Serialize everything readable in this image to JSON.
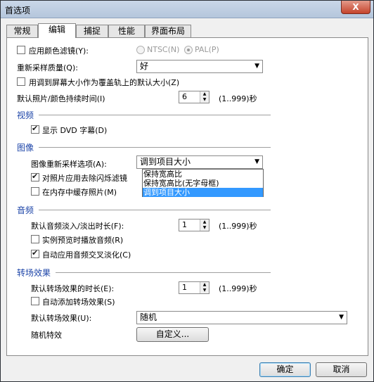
{
  "window": {
    "title": "首选项",
    "close_glyph": "X"
  },
  "tabs": [
    {
      "label": "常规"
    },
    {
      "label": "编辑"
    },
    {
      "label": "捕捉"
    },
    {
      "label": "性能"
    },
    {
      "label": "界面布局"
    }
  ],
  "color_filter": {
    "label": "应用颜色滤镜(Y):",
    "checked": false,
    "ntsc": "NTSC(N)",
    "pal": "PAL(P)",
    "selected": "PAL"
  },
  "resample_quality": {
    "label": "重新采样质量(Q):",
    "value": "好"
  },
  "fit_overlay": {
    "label": "用调到屏幕大小作为覆盖轨上的默认大小(Z)",
    "checked": false
  },
  "photo_duration": {
    "label": "默认照片/颜色持续时间(I)",
    "value": "6",
    "range": "(1..999)秒"
  },
  "video_section": {
    "title": "视频",
    "show_dvd_subtitle": {
      "label": "显示 DVD 字幕(D)",
      "checked": true
    }
  },
  "image_section": {
    "title": "图像",
    "resample_option": {
      "label": "图像重新采样选项(A):",
      "value": "调到项目大小",
      "options": [
        "保持宽高比",
        "保持宽高比(无字母框)",
        "调到项目大小"
      ],
      "selected_index": 2
    },
    "deflicker": {
      "label": "对照片应用去除闪烁滤镜",
      "checked": true
    },
    "cache_photo": {
      "label": "在内存中缓存照片(M)",
      "checked": false
    }
  },
  "audio_section": {
    "title": "音频",
    "fade_duration": {
      "label": "默认音频淡入/淡出时长(F):",
      "value": "1",
      "range": "(1..999)秒"
    },
    "preview_audio": {
      "label": "实例预览时播放音频(R)",
      "checked": false
    },
    "auto_crossfade": {
      "label": "自动应用音频交叉淡化(C)",
      "checked": true
    }
  },
  "transition_section": {
    "title": "转场效果",
    "duration": {
      "label": "默认转场效果的时长(E):",
      "value": "1",
      "range": "(1..999)秒"
    },
    "auto_add": {
      "label": "自动添加转场效果(S)",
      "checked": false
    },
    "default_effect": {
      "label": "默认转场效果(U):",
      "value": "随机"
    },
    "random_effects": {
      "label": "随机特效",
      "customize_button": "自定义..."
    }
  },
  "footer": {
    "ok": "确定",
    "cancel": "取消"
  }
}
